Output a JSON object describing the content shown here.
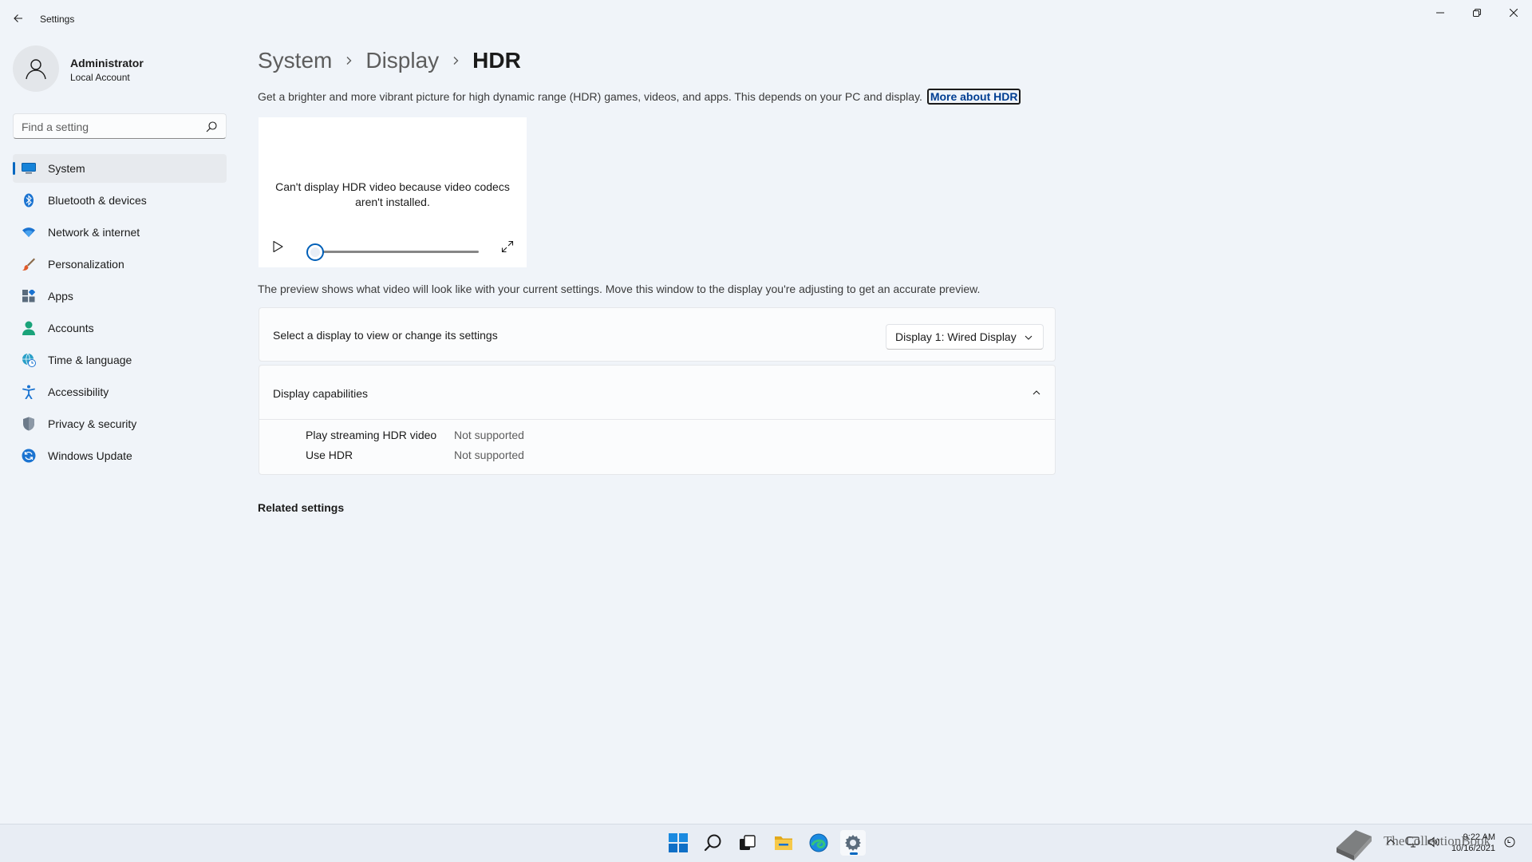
{
  "window": {
    "app_title": "Settings"
  },
  "profile": {
    "name": "Administrator",
    "account_type": "Local Account"
  },
  "search": {
    "placeholder": "Find a setting"
  },
  "sidebar": {
    "items": [
      {
        "label": "System",
        "icon": "system-display-icon",
        "active": true
      },
      {
        "label": "Bluetooth & devices",
        "icon": "bluetooth-icon"
      },
      {
        "label": "Network & internet",
        "icon": "wifi-icon"
      },
      {
        "label": "Personalization",
        "icon": "brush-icon"
      },
      {
        "label": "Apps",
        "icon": "apps-icon"
      },
      {
        "label": "Accounts",
        "icon": "person-icon"
      },
      {
        "label": "Time & language",
        "icon": "globe-clock-icon"
      },
      {
        "label": "Accessibility",
        "icon": "accessibility-icon"
      },
      {
        "label": "Privacy & security",
        "icon": "shield-icon"
      },
      {
        "label": "Windows Update",
        "icon": "update-icon"
      }
    ]
  },
  "breadcrumb": {
    "items": [
      "System",
      "Display",
      "HDR"
    ]
  },
  "main": {
    "description": "Get a brighter and more vibrant picture for high dynamic range (HDR) games, videos, and apps. This depends on your PC and display.",
    "learn_more": "More about HDR",
    "preview_message": "Can't display HDR video because video codecs aren't installed.",
    "preview_progress": 0,
    "preview_note": "The preview shows what video will look like with your current settings. Move this window to the display you're adjusting to get an accurate preview.",
    "select_display": {
      "label": "Select a display to view or change its settings",
      "value": "Display 1: Wired Display"
    },
    "capabilities": {
      "title": "Display capabilities",
      "expanded": true,
      "rows": [
        {
          "name": "Play streaming HDR video",
          "value": "Not supported"
        },
        {
          "name": "Use HDR",
          "value": "Not supported"
        }
      ]
    },
    "related_settings": "Related settings"
  },
  "taskbar": {
    "apps": [
      "start-icon",
      "search-icon",
      "task-view-icon",
      "file-explorer-icon",
      "edge-icon",
      "settings-icon"
    ],
    "active_app": "settings-icon",
    "clock_time": "9:22 AM",
    "clock_date": "10/16/2021",
    "watermark_text": "TheCollectionBook"
  },
  "colors": {
    "accent": "#0067c0",
    "background": "#f0f4f9",
    "card": "#fbfcfd"
  }
}
